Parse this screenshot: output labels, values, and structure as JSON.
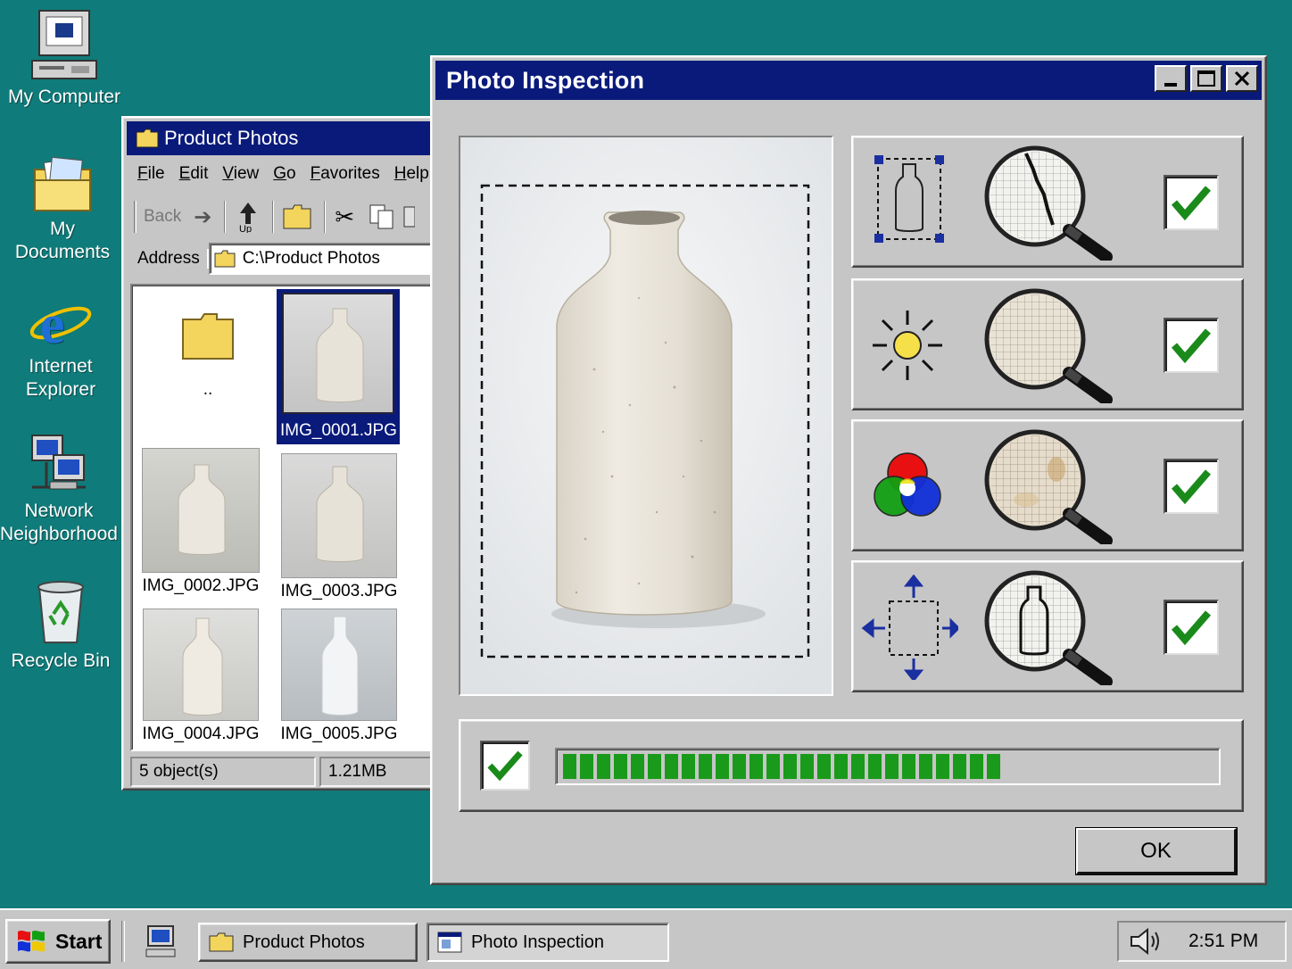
{
  "desktop": {
    "icons": [
      {
        "label": "My Computer"
      },
      {
        "label": "My Documents"
      },
      {
        "label_line1": "Internet",
        "label_line2": "Explorer"
      },
      {
        "label_line1": "Network",
        "label_line2": "Neighborhood"
      },
      {
        "label": "Recycle Bin"
      }
    ]
  },
  "explorer": {
    "title": "Product Photos",
    "menu": [
      "File",
      "Edit",
      "View",
      "Go",
      "Favorites",
      "Help"
    ],
    "toolbar": {
      "back": "Back",
      "up": "Up"
    },
    "address_label": "Address",
    "address_value": "C:\\Product Photos",
    "files": [
      {
        "name": ".."
      },
      {
        "name": "IMG_0001.JPG",
        "selected": true
      },
      {
        "name": "IMG_0002.JPG"
      },
      {
        "name": "IMG_0003.JPG"
      },
      {
        "name": "IMG_0004.JPG"
      },
      {
        "name": "IMG_0005.JPG"
      }
    ],
    "status_count": "5 object(s)",
    "status_size": "1.21MB"
  },
  "dialog": {
    "title": "Photo Inspection",
    "checks": [
      {
        "icon": "bounding-box-icon",
        "inspect": "crack-magnifier-icon",
        "checked": true
      },
      {
        "icon": "brightness-icon",
        "inspect": "exposure-magnifier-icon",
        "checked": true
      },
      {
        "icon": "rgb-color-icon",
        "inspect": "color-magnifier-icon",
        "checked": true
      },
      {
        "icon": "alignment-icon",
        "inspect": "shape-magnifier-icon",
        "checked": true
      }
    ],
    "progress": {
      "checked": true,
      "filled_segments": 26,
      "total_segments": 40
    },
    "ok_label": "OK"
  },
  "taskbar": {
    "start_label": "Start",
    "tasks": [
      "Product Photos",
      "Photo Inspection"
    ],
    "clock": "2:51 PM"
  },
  "colors": {
    "desktop": "#0f7b7a",
    "titlebar": "#0a1a7a",
    "progress": "#1a9a1a",
    "check": "#1a8a1a"
  }
}
